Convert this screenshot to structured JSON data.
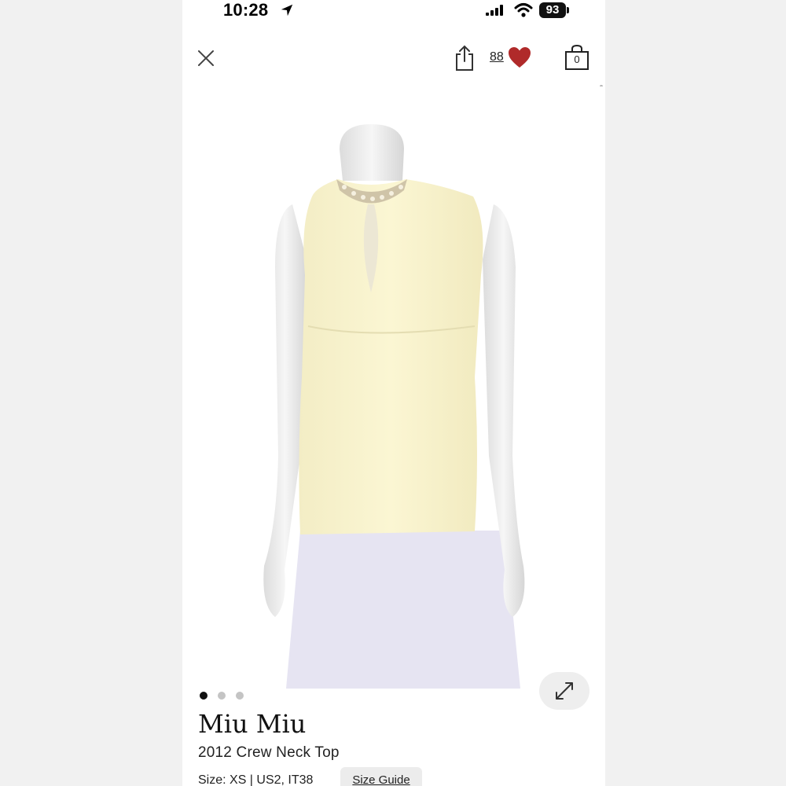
{
  "status_bar": {
    "time": "10:28",
    "battery": "93"
  },
  "header": {
    "likes_count": "88",
    "bag_count": "0",
    "colors": {
      "heart": "#b02a2a",
      "icon": "#222222"
    }
  },
  "gallery": {
    "dots": [
      true,
      false,
      false
    ]
  },
  "product": {
    "brand": "Miu Miu",
    "title": "2012 Crew Neck Top",
    "size_text": "Size: XS | US2, IT38",
    "size_guide_label": "Size Guide"
  }
}
